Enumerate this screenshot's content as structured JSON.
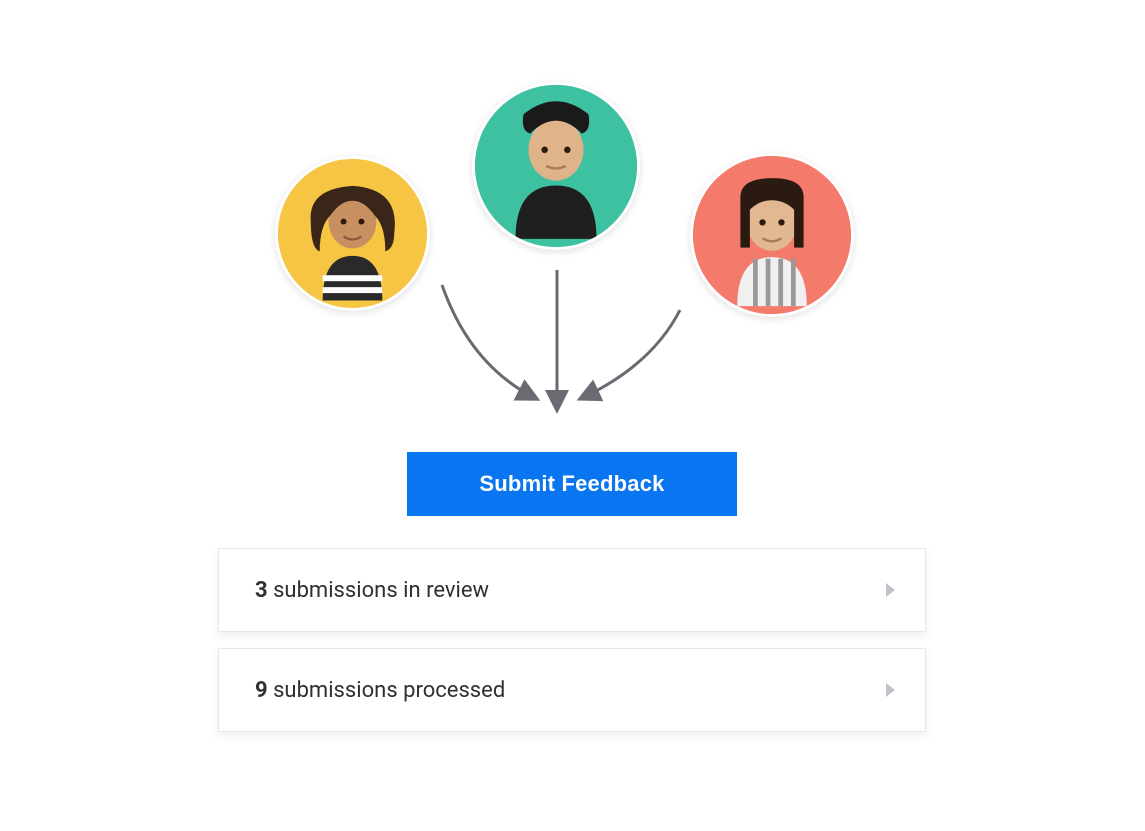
{
  "avatars": [
    {
      "bg": "#f6c544"
    },
    {
      "bg": "#3ec1a1"
    },
    {
      "bg": "#f47a6b"
    }
  ],
  "button": {
    "label": "Submit Feedback"
  },
  "cards": [
    {
      "count": "3",
      "label": " submissions in review"
    },
    {
      "count": "9",
      "label": " submissions processed"
    }
  ]
}
